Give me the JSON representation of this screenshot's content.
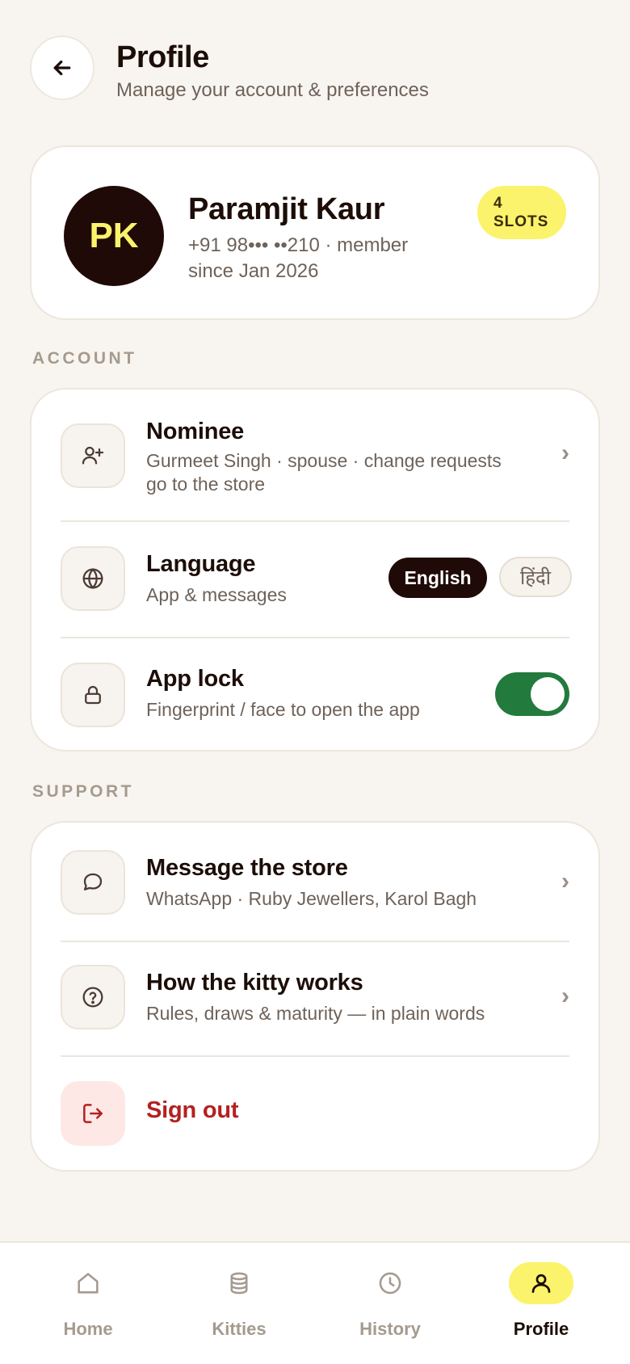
{
  "header": {
    "title": "Profile",
    "subtitle": "Manage your account & preferences"
  },
  "profile": {
    "initials": "PK",
    "name": "Paramjit Kaur",
    "meta": "+91 98••• ••210 · member since Jan 2026",
    "slots_number": "4",
    "slots_label": "SLOTS"
  },
  "account": {
    "label": "ACCOUNT",
    "nominee": {
      "title": "Nominee",
      "subtitle": "Gurmeet Singh · spouse · change requests go to the store",
      "icon": "user-plus-icon"
    },
    "language": {
      "title": "Language",
      "subtitle": "App & messages",
      "options": [
        "English",
        "हिंदी"
      ],
      "selected": "English",
      "icon": "globe-icon"
    },
    "app_lock": {
      "title": "App lock",
      "subtitle": "Fingerprint / face to open the app",
      "enabled": true,
      "icon": "lock-icon"
    }
  },
  "support": {
    "label": "SUPPORT",
    "message": {
      "title": "Message the store",
      "subtitle": "WhatsApp · Ruby Jewellers, Karol Bagh",
      "icon": "chat-bubble-icon"
    },
    "how_it_works": {
      "title": "How the kitty works",
      "subtitle": "Rules, draws & maturity — in plain words",
      "icon": "help-circle-icon"
    },
    "sign_out": {
      "title": "Sign out",
      "icon": "logout-icon"
    }
  },
  "nav": {
    "items": [
      {
        "label": "Home",
        "icon": "home-icon"
      },
      {
        "label": "Kitties",
        "icon": "coins-stack-icon"
      },
      {
        "label": "History",
        "icon": "clock-icon"
      },
      {
        "label": "Profile",
        "icon": "user-icon"
      }
    ],
    "active": "Profile"
  },
  "colors": {
    "accent_yellow": "#fbf36b",
    "dark": "#1f0a07",
    "toggle_green": "#227a3d",
    "danger": "#b32121",
    "background": "#f8f5f0"
  }
}
